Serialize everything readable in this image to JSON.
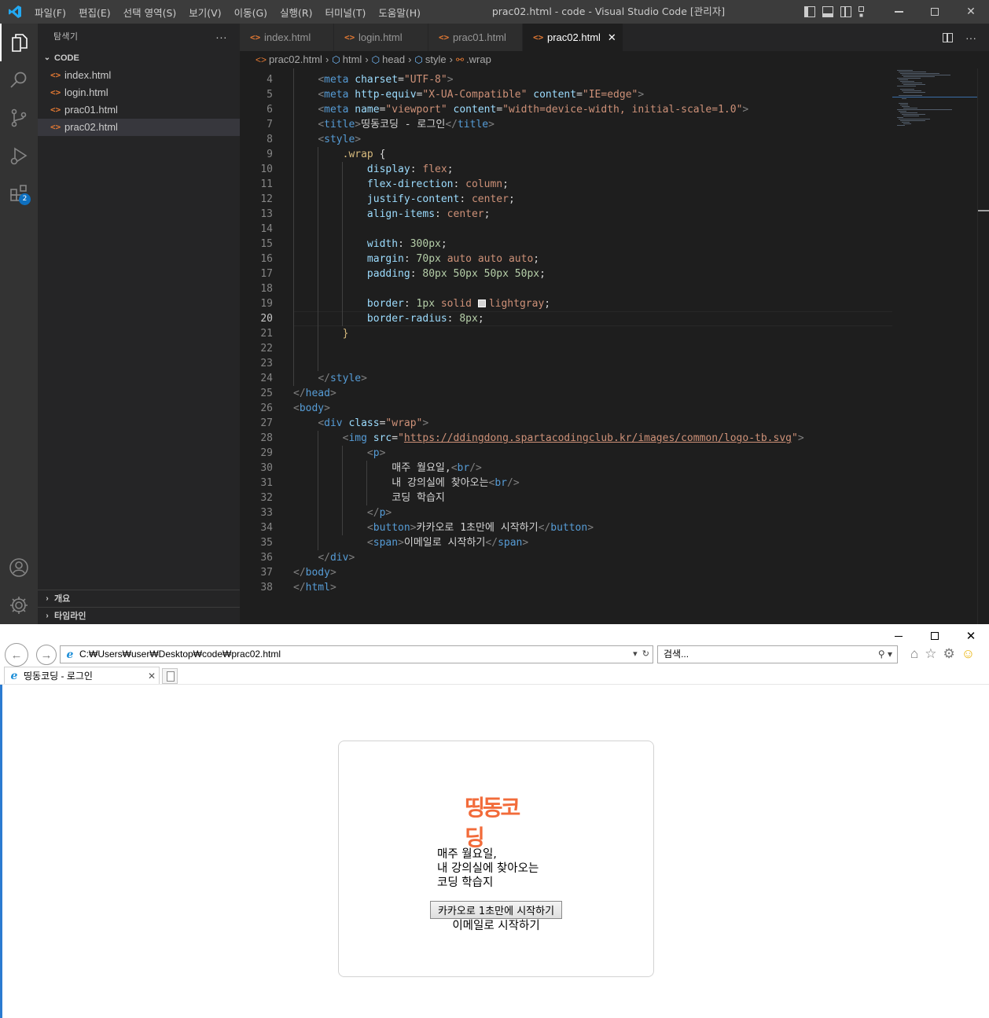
{
  "vscode": {
    "menu": [
      "파일(F)",
      "편집(E)",
      "선택 영역(S)",
      "보기(V)",
      "이동(G)",
      "실행(R)",
      "터미널(T)",
      "도움말(H)"
    ],
    "window_title": "prac02.html - code - Visual Studio Code [관리자]",
    "activity_badge": "2",
    "sidebar": {
      "title": "탐색기",
      "more": "···",
      "folder": "CODE",
      "files": [
        "index.html",
        "login.html",
        "prac01.html",
        "prac02.html"
      ],
      "selected_file": "prac02.html",
      "outline": "개요",
      "timeline": "타임라인"
    },
    "tabs": [
      "index.html",
      "login.html",
      "prac01.html",
      "prac02.html"
    ],
    "active_tab": "prac02.html",
    "breadcrumb": [
      "prac02.html",
      "html",
      "head",
      "style",
      ".wrap"
    ],
    "current_line": 20,
    "code_lines": [
      {
        "n": 4,
        "html": "    <span class='t-br'>&lt;</span><span class='t-tag'>meta</span> <span class='t-attr'>charset</span>=<span class='t-str'>\"UTF-8\"</span><span class='t-br'>&gt;</span>"
      },
      {
        "n": 5,
        "html": "    <span class='t-br'>&lt;</span><span class='t-tag'>meta</span> <span class='t-attr'>http-equiv</span>=<span class='t-str'>\"X-UA-Compatible\"</span> <span class='t-attr'>content</span>=<span class='t-str'>\"IE=edge\"</span><span class='t-br'>&gt;</span>"
      },
      {
        "n": 6,
        "html": "    <span class='t-br'>&lt;</span><span class='t-tag'>meta</span> <span class='t-attr'>name</span>=<span class='t-str'>\"viewport\"</span> <span class='t-attr'>content</span>=<span class='t-str'>\"width=device-width, initial-scale=1.0\"</span><span class='t-br'>&gt;</span>"
      },
      {
        "n": 7,
        "html": "    <span class='t-br'>&lt;</span><span class='t-tag'>title</span><span class='t-br'>&gt;</span><span class='t-txt'>띵동코딩 - 로그인</span><span class='t-br'>&lt;/</span><span class='t-tag'>title</span><span class='t-br'>&gt;</span>"
      },
      {
        "n": 8,
        "html": "    <span class='t-br'>&lt;</span><span class='t-tag'>style</span><span class='t-br'>&gt;</span>"
      },
      {
        "n": 9,
        "html": "        <span class='t-sel'>.wrap</span> <span class='t-pun'>{</span>"
      },
      {
        "n": 10,
        "html": "            <span class='t-prop'>display</span>: <span class='t-val'>flex</span>;"
      },
      {
        "n": 11,
        "html": "            <span class='t-prop'>flex-direction</span>: <span class='t-val'>column</span>;"
      },
      {
        "n": 12,
        "html": "            <span class='t-prop'>justify-content</span>: <span class='t-val'>center</span>;"
      },
      {
        "n": 13,
        "html": "            <span class='t-prop'>align-items</span>: <span class='t-val'>center</span>;"
      },
      {
        "n": 14,
        "html": ""
      },
      {
        "n": 15,
        "html": "            <span class='t-prop'>width</span>: <span class='t-num'>300px</span>;"
      },
      {
        "n": 16,
        "html": "            <span class='t-prop'>margin</span>: <span class='t-num'>70px</span> <span class='t-val'>auto</span> <span class='t-val'>auto</span> <span class='t-val'>auto</span>;"
      },
      {
        "n": 17,
        "html": "            <span class='t-prop'>padding</span>: <span class='t-num'>80px</span> <span class='t-num'>50px</span> <span class='t-num'>50px</span> <span class='t-num'>50px</span>;"
      },
      {
        "n": 18,
        "html": ""
      },
      {
        "n": 19,
        "html": "            <span class='t-prop'>border</span>: <span class='t-num'>1px</span> <span class='t-val'>solid</span> <span class='swatch'></span><span class='t-val'>lightgray</span>;"
      },
      {
        "n": 20,
        "html": "            <span class='t-prop'>border-radius</span>: <span class='t-num'>8px</span>;"
      },
      {
        "n": 21,
        "html": "        <span class='t-sel'>}</span>"
      },
      {
        "n": 22,
        "html": ""
      },
      {
        "n": 23,
        "html": ""
      },
      {
        "n": 24,
        "html": "    <span class='t-br'>&lt;/</span><span class='t-tag'>style</span><span class='t-br'>&gt;</span>"
      },
      {
        "n": 25,
        "html": "<span class='t-br'>&lt;/</span><span class='t-tag'>head</span><span class='t-br'>&gt;</span>"
      },
      {
        "n": 26,
        "html": "<span class='t-br'>&lt;</span><span class='t-tag'>body</span><span class='t-br'>&gt;</span>"
      },
      {
        "n": 27,
        "html": "    <span class='t-br'>&lt;</span><span class='t-tag'>div</span> <span class='t-attr'>class</span>=<span class='t-str'>\"wrap\"</span><span class='t-br'>&gt;</span>"
      },
      {
        "n": 28,
        "html": "        <span class='t-br'>&lt;</span><span class='t-tag'>img</span> <span class='t-attr'>src</span>=<span class='t-str'>\"</span><span class='t-link'>https://ddingdong.spartacodingclub.kr/images/common/logo-tb.svg</span><span class='t-str'>\"</span><span class='t-br'>&gt;</span>"
      },
      {
        "n": 29,
        "html": "            <span class='t-br'>&lt;</span><span class='t-tag'>p</span><span class='t-br'>&gt;</span>"
      },
      {
        "n": 30,
        "html": "                <span class='t-txt'>매주 월요일,</span><span class='t-br'>&lt;</span><span class='t-tag'>br</span><span class='t-br'>/&gt;</span>"
      },
      {
        "n": 31,
        "html": "                <span class='t-txt'>내 강의실에 찾아오는</span><span class='t-br'>&lt;</span><span class='t-tag'>br</span><span class='t-br'>/&gt;</span>"
      },
      {
        "n": 32,
        "html": "                <span class='t-txt'>코딩 학습지</span>"
      },
      {
        "n": 33,
        "html": "            <span class='t-br'>&lt;/</span><span class='t-tag'>p</span><span class='t-br'>&gt;</span>"
      },
      {
        "n": 34,
        "html": "            <span class='t-br'>&lt;</span><span class='t-tag'>button</span><span class='t-br'>&gt;</span><span class='t-txt'>카카오로 1초만에 시작하기</span><span class='t-br'>&lt;/</span><span class='t-tag'>button</span><span class='t-br'>&gt;</span>"
      },
      {
        "n": 35,
        "html": "            <span class='t-br'>&lt;</span><span class='t-tag'>span</span><span class='t-br'>&gt;</span><span class='t-txt'>이메일로 시작하기</span><span class='t-br'>&lt;/</span><span class='t-tag'>span</span><span class='t-br'>&gt;</span>"
      },
      {
        "n": 36,
        "html": "    <span class='t-br'>&lt;/</span><span class='t-tag'>div</span><span class='t-br'>&gt;</span>"
      },
      {
        "n": 37,
        "html": "<span class='t-br'>&lt;/</span><span class='t-tag'>body</span><span class='t-br'>&gt;</span>"
      },
      {
        "n": 38,
        "html": "<span class='t-br'>&lt;/</span><span class='t-tag'>html</span><span class='t-br'>&gt;</span>"
      }
    ]
  },
  "ie": {
    "address": "C:₩Users₩user₩Desktop₩code₩prac02.html",
    "search_placeholder": "검색...",
    "tab_title": "띵동코딩 - 로그인",
    "page": {
      "logo_text": "띵동코딩",
      "p_lines": [
        "매주 월요일,",
        "내 강의실에 찾아오는",
        "코딩 학습지"
      ],
      "button": "카카오로 1초만에 시작하기",
      "email": "이메일로 시작하기"
    }
  }
}
